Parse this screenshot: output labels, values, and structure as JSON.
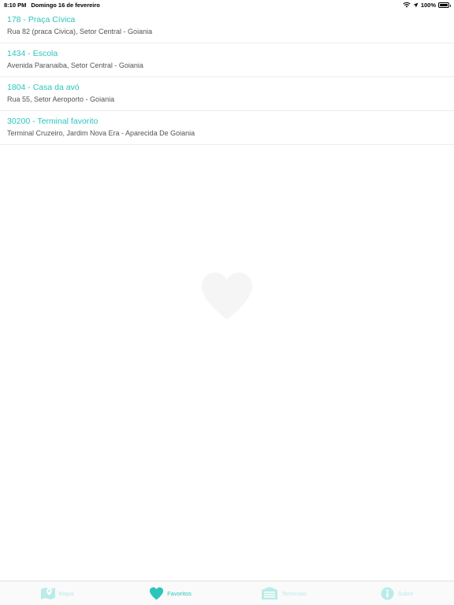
{
  "status_bar": {
    "time": "8:10 PM",
    "date": "Domingo 16 de fevereiro",
    "battery": "100%"
  },
  "favorites": [
    {
      "title": "178 - Praça Cívica",
      "address": "Rua 82 (praca Civica), Setor Central - Goiania"
    },
    {
      "title": "1434 - Escola",
      "address": "Avenida Paranaiba, Setor Central - Goiania"
    },
    {
      "title": "1804 - Casa da avó",
      "address": "Rua 55, Setor Aeroporto - Goiania"
    },
    {
      "title": "30200 - Terminal favorito",
      "address": "Terminal Cruzeiro, Jardim Nova Era - Aparecida De Goiania"
    }
  ],
  "tab_bar": {
    "tabs": [
      {
        "label": "Mapa",
        "icon": "map-icon",
        "active": false
      },
      {
        "label": "Favoritos",
        "icon": "heart-icon",
        "active": true
      },
      {
        "label": "Terminais",
        "icon": "terminal-building-icon",
        "active": false
      },
      {
        "label": "Sobre",
        "icon": "info-icon",
        "active": false
      }
    ]
  },
  "colors": {
    "accent": "#2cc5bb",
    "accent_inactive": "#b9ece8",
    "empty_heart": "#f5f5f5"
  }
}
